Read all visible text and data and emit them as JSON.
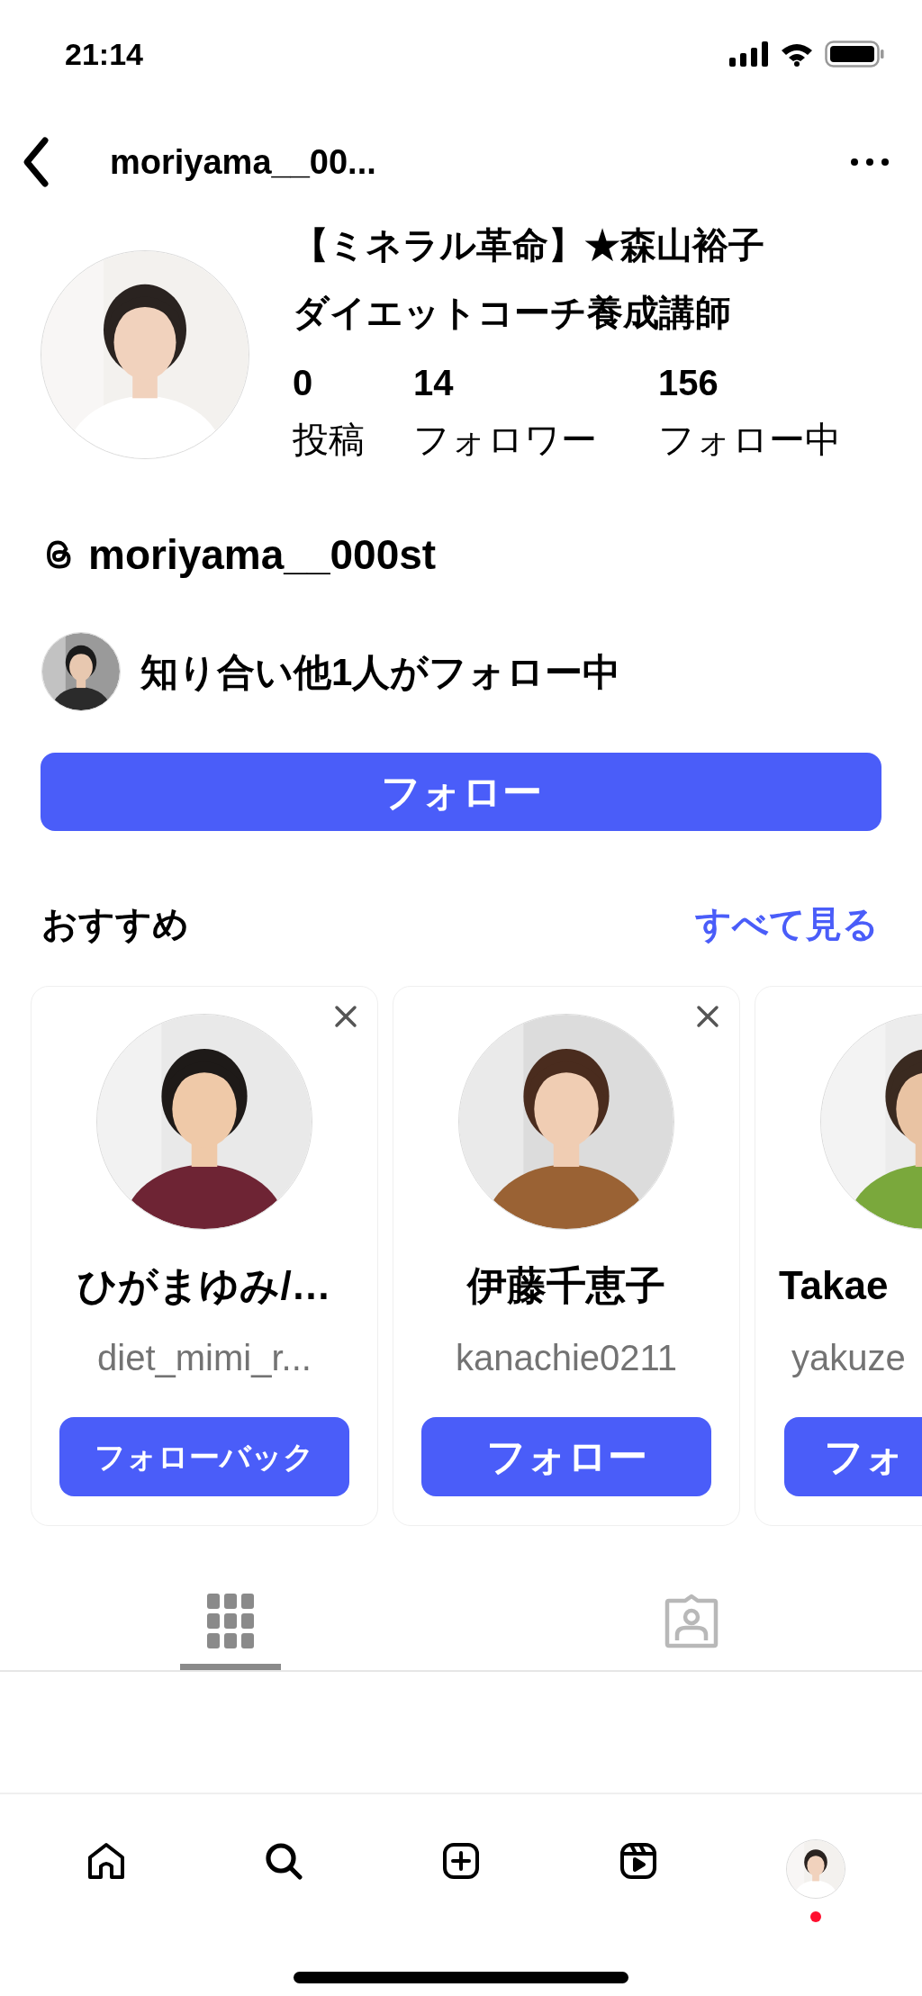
{
  "status_bar": {
    "time": "21:14"
  },
  "header": {
    "username": "moriyama__00..."
  },
  "profile": {
    "name_lines": [
      "【ミネラル革命】★森山裕子",
      "ダイエットコーチ養成講師"
    ],
    "stats": [
      {
        "value": "0",
        "label": "投稿"
      },
      {
        "value": "14",
        "label": "フォロワー"
      },
      {
        "value": "156",
        "label": "フォロー中"
      }
    ],
    "threads_handle": "moriyama__000st",
    "mutual_followers": "知り合い他1人がフォロー中",
    "follow_button": "フォロー"
  },
  "suggestions": {
    "title": "おすすめ",
    "see_all": "すべて見る",
    "cards": [
      {
        "name": "ひがまゆみ/…",
        "handle": "diet_mimi_r...",
        "button": "フォローバック",
        "dismissible": true
      },
      {
        "name": "伊藤千恵子",
        "handle": "kanachie0211",
        "button": "フォロー",
        "dismissible": true
      },
      {
        "name": "Takae",
        "handle": "yakuze",
        "button": "フォ",
        "dismissible": false
      }
    ]
  },
  "content_tabs": [
    {
      "kind": "grid",
      "selected": true
    },
    {
      "kind": "tagged",
      "selected": false
    }
  ],
  "bottom_nav": [
    {
      "kind": "home",
      "notification": false
    },
    {
      "kind": "search",
      "notification": false
    },
    {
      "kind": "create",
      "notification": false
    },
    {
      "kind": "reels",
      "notification": false
    },
    {
      "kind": "profile",
      "notification": true
    }
  ]
}
